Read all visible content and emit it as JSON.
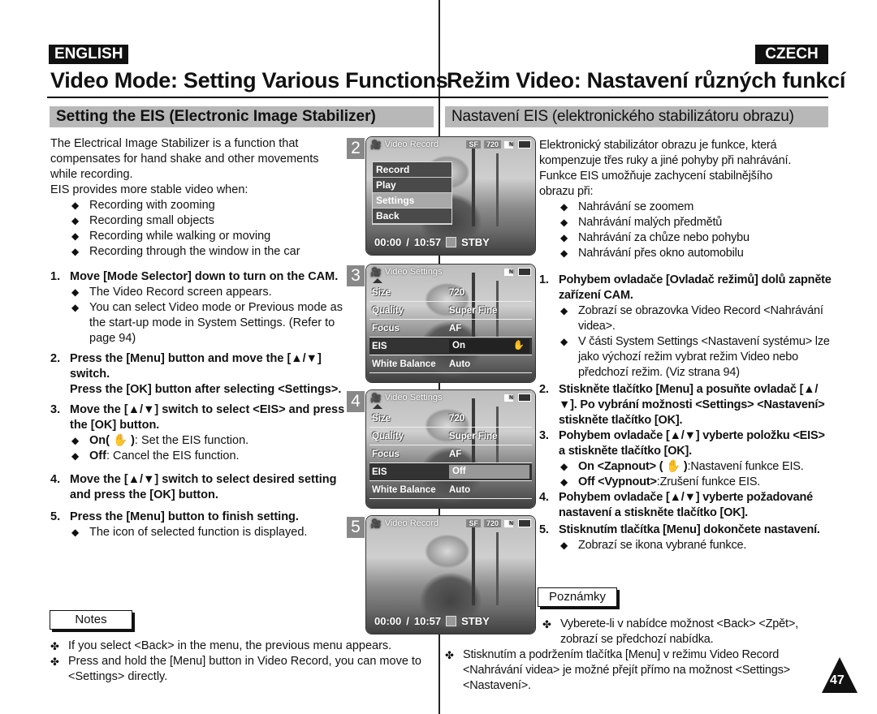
{
  "lang": {
    "english": "ENGLISH",
    "czech": "CZECH"
  },
  "en": {
    "title": "Video Mode: Setting Various Functions",
    "subtitle": "Setting the EIS (Electronic Image Stabilizer)",
    "intro": [
      "The Electrical Image Stabilizer is a function that",
      "compensates for hand shake and other movements",
      "while recording.",
      "EIS provides more stable video when:"
    ],
    "bullets": [
      "Recording with zooming",
      "Recording small objects",
      "Recording while walking or moving",
      "Recording through the window in the car"
    ],
    "steps": [
      {
        "num": "1.",
        "text": "Move [Mode Selector] down to turn on the CAM.",
        "subs": [
          "The Video Record screen appears.",
          "You can select Video mode or Previous mode as the start-up mode in System Settings. (Refer to page 94)"
        ]
      },
      {
        "num": "2.",
        "text": "Press the [Menu] button and move the [▲/▼] switch.",
        "text2": "Press the [OK] button after selecting <Settings>."
      },
      {
        "num": "3.",
        "text": "Move the [▲/▼] switch to select <EIS> and press the [OK] button.",
        "on_label": "On( ✋ )",
        "on_desc": ": Set the EIS function.",
        "off_label": "Off",
        "off_desc": ": Cancel the EIS function."
      },
      {
        "num": "4.",
        "text": "Move the [▲/▼] switch to select desired setting and press the [OK] button."
      },
      {
        "num": "5.",
        "text": "Press the [Menu] button to finish setting.",
        "subs": [
          "The icon of selected function is displayed."
        ]
      }
    ],
    "notes_label": "Notes",
    "notes": [
      "If you select <Back> in the menu, the previous menu appears.",
      "Press and hold the [Menu] button in Video Record, you can move to <Settings> directly."
    ]
  },
  "cz": {
    "title": "Režim Video: Nastavení různých funkcí",
    "subtitle": "Nastavení EIS (elektronického stabilizátoru obrazu)",
    "intro": [
      "Elektronický stabilizátor obrazu je funkce, která",
      "kompenzuje třes ruky a jiné pohyby při nahrávání.",
      "Funkce EIS umožňuje zachycení stabilnějšího",
      "obrazu při:"
    ],
    "bullets": [
      "Nahrávání se zoomem",
      "Nahrávání malých předmětů",
      "Nahrávání za chůze nebo pohybu",
      "Nahrávání přes okno automobilu"
    ],
    "steps": [
      {
        "num": "1.",
        "text": "Pohybem ovladače [Ovladač režimů] dolů zapněte zařízení CAM.",
        "subs": [
          "Zobrazí se obrazovka Video Record <Nahrávání videa>.",
          "V části System Settings <Nastavení systému> lze jako výchozí režim vybrat režim Video nebo předchozí režim. (Viz strana 94)"
        ]
      },
      {
        "num": "2.",
        "text": "Stiskněte tlačítko [Menu] a posuňte ovladač [▲/▼]. Po vybrání možnosti <Settings> <Nastavení> stiskněte tlačítko [OK]."
      },
      {
        "num": "3.",
        "text": "Pohybem ovladače [▲/▼] vyberte položku <EIS> a stiskněte tlačítko [OK].",
        "on_label": "On <Zapnout> ( ✋ )",
        "on_desc": ":Nastavení funkce EIS.",
        "off_label": "Off <Vypnout>",
        "off_desc": ":Zrušení funkce EIS."
      },
      {
        "num": "4.",
        "text": "Pohybem ovladače [▲/▼] vyberte požadované nastavení a stiskněte tlačítko [OK]."
      },
      {
        "num": "5.",
        "text": "Stisknutím tlačítka [Menu] dokončete nastavení.",
        "subs": [
          "Zobrazí se ikona vybrané funkce."
        ]
      }
    ],
    "notes_label": "Poznámky",
    "notes": [
      "Vyberete-li v nabídce možnost <Back> <Zpět>, zobrazí se předchozí nabídka.",
      "Stisknutím a podržením tlačítka [Menu] v režimu Video Record <Nahrávání videa> je možné přejít přímo na možnost <Settings> <Nastavení>."
    ]
  },
  "screens": {
    "s2": {
      "badge": "2",
      "title": "Video Record",
      "sf": "SF",
      "res": "720",
      "menu": [
        "Record",
        "Play",
        "Settings",
        "Back"
      ],
      "selected": "Settings",
      "time": "00:00",
      "remain": "10:57",
      "status": "STBY"
    },
    "s3": {
      "badge": "3",
      "title": "Video Settings",
      "rows": [
        [
          "Size",
          "720"
        ],
        [
          "Quality",
          "Super Fine"
        ],
        [
          "Focus",
          "AF"
        ],
        [
          "EIS",
          "On"
        ],
        [
          "White Balance",
          "Auto"
        ]
      ]
    },
    "s4": {
      "badge": "4",
      "title": "Video Settings",
      "rows": [
        [
          "Size",
          "720"
        ],
        [
          "Quality",
          "Super Fine"
        ],
        [
          "Focus",
          "AF"
        ],
        [
          "EIS",
          "Off"
        ],
        [
          "White Balance",
          "Auto"
        ]
      ]
    },
    "s5": {
      "badge": "5",
      "title": "Video Record",
      "sf": "SF",
      "res": "720",
      "time": "00:00",
      "remain": "10:57",
      "status": "STBY"
    }
  },
  "page_number": "47"
}
